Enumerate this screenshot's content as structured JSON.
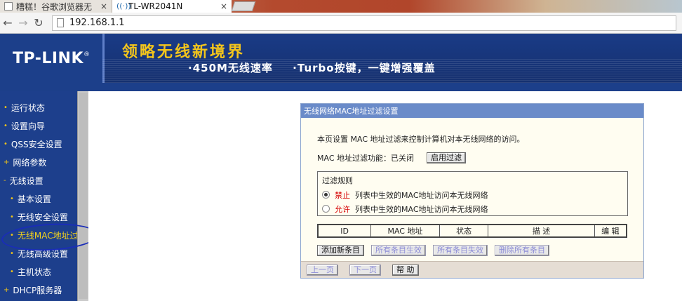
{
  "browser": {
    "tabs": [
      {
        "title": "糟糕！谷歌浏览器无",
        "close": "×"
      },
      {
        "title": "TL-WR2041N",
        "close": "×"
      }
    ],
    "address": "192.168.1.1"
  },
  "banner": {
    "logo": "TP-LINK",
    "logo_mark": "®",
    "slogan": "领略无线新境界",
    "sub1": "·450M无线速率",
    "sub2": "·Turbo按键，一键增强覆盖"
  },
  "menu": {
    "items": [
      {
        "label": "运行状态",
        "sub": false
      },
      {
        "label": "设置向导",
        "sub": false
      },
      {
        "label": "QSS安全设置",
        "sub": false
      },
      {
        "label": "网络参数",
        "sub": false
      },
      {
        "label": "无线设置",
        "sub": false
      },
      {
        "label": "基本设置",
        "sub": true
      },
      {
        "label": "无线安全设置",
        "sub": true
      },
      {
        "label": "无线MAC地址过滤",
        "sub": true,
        "active": true
      },
      {
        "label": "无线高级设置",
        "sub": true
      },
      {
        "label": "主机状态",
        "sub": true
      },
      {
        "label": "DHCP服务器",
        "sub": false
      }
    ]
  },
  "panel": {
    "header": "无线网络MAC地址过滤设置",
    "description": "本页设置 MAC 地址过滤来控制计算机对本无线网络的访问。",
    "status_label": "MAC 地址过滤功能：已关闭",
    "enable_button": "启用过滤",
    "rules_title": "过滤规则",
    "rule_deny_key": "禁止",
    "rule_deny_text": "列表中生效的MAC地址访问本无线网络",
    "rule_allow_key": "允许",
    "rule_allow_text": "列表中生效的MAC地址访问本无线网络",
    "table_headers": [
      "ID",
      "MAC 地址",
      "状态",
      "描 述",
      "编 辑"
    ],
    "buttons": {
      "add": "添加新条目",
      "enable_all": "所有条目生效",
      "disable_all": "所有条目失效",
      "delete_all": "删除所有条目"
    },
    "pager": {
      "prev": "上一页",
      "next": "下一页",
      "help": "帮 助"
    }
  },
  "colors": {
    "menu_bg": "#1d3f8c",
    "panel_header": "#6a8bc9",
    "accent_yellow": "#f4d31c"
  }
}
